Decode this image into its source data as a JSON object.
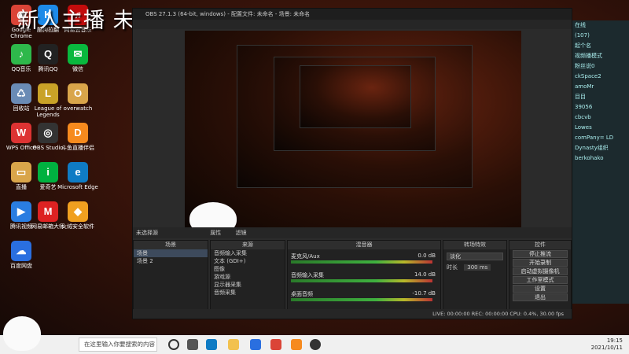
{
  "banner": {
    "text": "新人主播 未来百万主播 免费的关注走一走 荷富贵勿相忘"
  },
  "desktop": {
    "icons": [
      {
        "label": "Google Chrome",
        "glyph": "◉",
        "color": "#db4437"
      },
      {
        "label": "QQ音乐",
        "glyph": "♪",
        "color": "#2eb84b"
      },
      {
        "label": "回收站",
        "glyph": "♺",
        "color": "#6a8bb5"
      },
      {
        "label": "WPS Office",
        "glyph": "W",
        "color": "#d33"
      },
      {
        "label": "直播",
        "glyph": "▭",
        "color": "#d9a54a"
      },
      {
        "label": "腾讯视频",
        "glyph": "▶",
        "color": "#2a7de1"
      },
      {
        "label": "百度网盘",
        "glyph": "☁",
        "color": "#2a6fe0"
      },
      {
        "label": "酷狗拉翻",
        "glyph": "K",
        "color": "#1d8ae8"
      },
      {
        "label": "腾讯QQ",
        "glyph": "Q",
        "color": "#222"
      },
      {
        "label": "League of Legends",
        "glyph": "L",
        "color": "#c9a227"
      },
      {
        "label": "OBS Studio",
        "glyph": "◎",
        "color": "#333"
      },
      {
        "label": "爱奇艺",
        "glyph": "i",
        "color": "#00b140"
      },
      {
        "label": "网易邮箱大师",
        "glyph": "M",
        "color": "#d22"
      },
      {
        "label": "网易云音乐",
        "glyph": "♫",
        "color": "#c20c0c"
      },
      {
        "label": "微信",
        "glyph": "✉",
        "color": "#09b83e"
      },
      {
        "label": "overwatch",
        "glyph": "O",
        "color": "#d9a54a"
      },
      {
        "label": "斗鱼直播伴侣",
        "glyph": "D",
        "color": "#f68a1e"
      },
      {
        "label": "Microsoft Edge",
        "glyph": "e",
        "color": "#0f7bc4"
      },
      {
        "label": "火绒安全软件",
        "glyph": "◆",
        "color": "#f0a020"
      }
    ]
  },
  "obs": {
    "title": "OBS 27.1.3 (64-bit, windows) - 配置文件: 未命名 - 场景: 未命名",
    "scene_bar": "未选择源",
    "scene_bar_props": "属性",
    "scene_bar_filters": "滤镜",
    "docks": {
      "scenes": {
        "title": "场景",
        "items": [
          "场景",
          "场景 2"
        ]
      },
      "sources": {
        "title": "来源",
        "items": [
          "音频输入采集",
          "文本 (GDI+)",
          "图像",
          "游戏源",
          "显示器采集",
          "音频采集"
        ]
      },
      "mixer": {
        "title": "混音器",
        "tracks": [
          {
            "name": "麦克风/Aux",
            "db": "0.0 dB"
          },
          {
            "name": "音频输入采集",
            "db": "14.0 dB"
          },
          {
            "name": "桌面音频",
            "db": "-10.7 dB"
          }
        ]
      },
      "transitions": {
        "title": "转场特效",
        "type": "淡化",
        "duration_label": "时长",
        "duration": "300 ms"
      },
      "controls": {
        "title": "控件",
        "buttons": [
          "停止推流",
          "开始录制",
          "启动虚拟摄像机",
          "工作室模式",
          "设置",
          "退出"
        ]
      }
    },
    "status": "LIVE: 00:00:00   REC: 00:00:00   CPU: 0.4%, 30.00 fps"
  },
  "chat": {
    "messages": [
      "在线",
      "(107)",
      "起个名",
      "视频播模式",
      "粉丝说0",
      "ckSpace2",
      "amoMr",
      "目目",
      "39056",
      "cbcvb",
      "Lowes",
      "comPany= LD",
      "Dynasty组织",
      "berkohako"
    ]
  },
  "taskbar": {
    "search_placeholder": "在这里输入你要搜索的内容",
    "time": "19:15",
    "date": "2021/10/11"
  }
}
